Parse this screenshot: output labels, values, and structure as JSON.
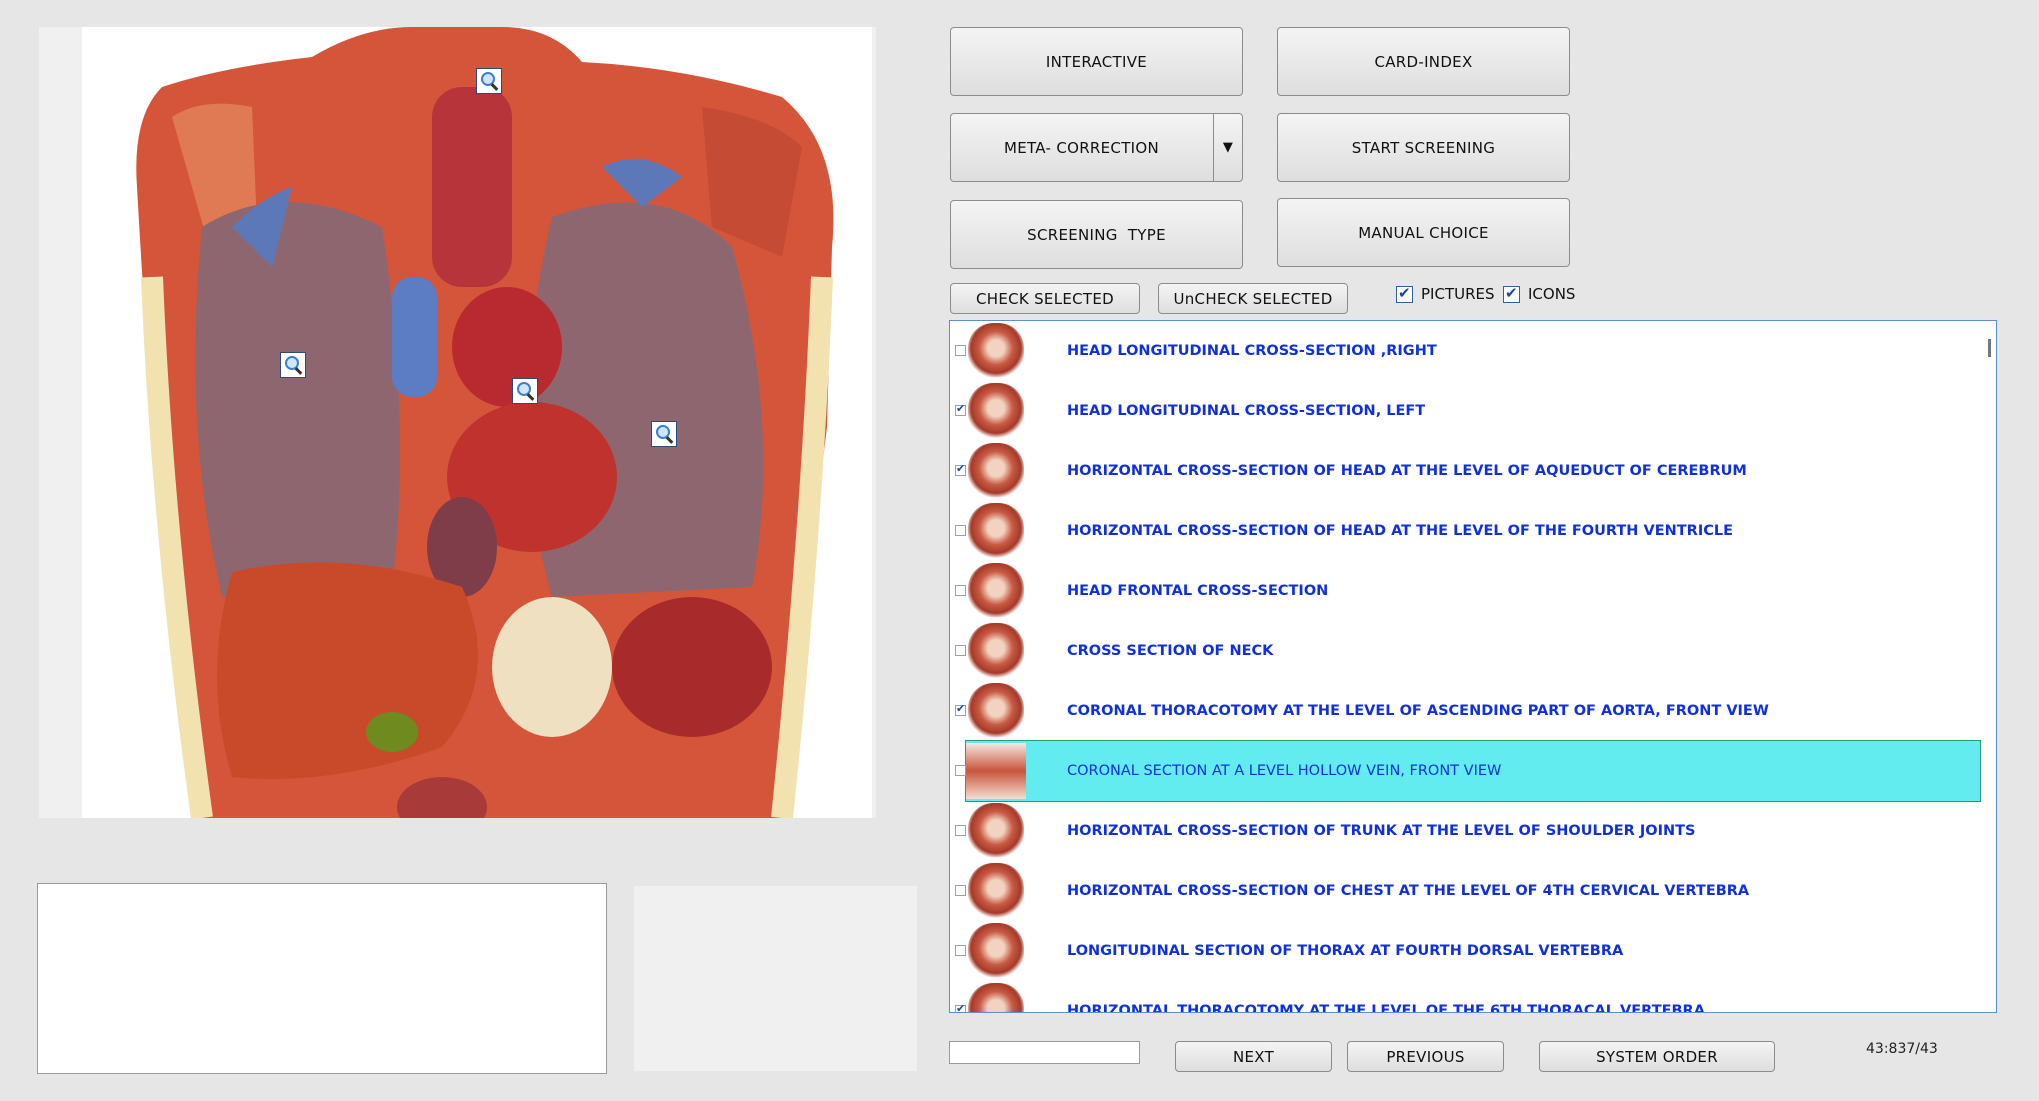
{
  "buttons": {
    "interactive": "INTERACTIVE",
    "card_index": "CARD-INDEX",
    "meta_correction": "META- CORRECTION",
    "meta_arrow": "▼",
    "start_screening": "START SCREENING",
    "screening_type": "SCREENING  TYPE",
    "manual_choice": "MANUAL CHOICE",
    "check_selected": "CHECK SELECTED",
    "uncheck_selected": "UnCHECK SELECTED",
    "next": "NEXT",
    "previous": "PREVIOUS",
    "system_order": "SYSTEM ORDER"
  },
  "options": {
    "pictures": {
      "label": "PICTURES",
      "checked": true
    },
    "icons": {
      "label": "ICONS",
      "checked": true
    }
  },
  "list": {
    "items": [
      {
        "label": "HEAD LONGITUDINAL CROSS-SECTION ,RIGHT",
        "checked": false,
        "selected": false
      },
      {
        "label": "HEAD LONGITUDINAL CROSS-SECTION, LEFT",
        "checked": true,
        "selected": false
      },
      {
        "label": "HORIZONTAL CROSS-SECTION OF HEAD AT THE LEVEL OF AQUEDUCT OF CEREBRUM",
        "checked": true,
        "selected": false
      },
      {
        "label": "HORIZONTAL CROSS-SECTION OF HEAD AT THE LEVEL OF THE FOURTH VENTRICLE",
        "checked": false,
        "selected": false
      },
      {
        "label": "HEAD FRONTAL CROSS-SECTION",
        "checked": false,
        "selected": false
      },
      {
        "label": "CROSS SECTION OF NECK",
        "checked": false,
        "selected": false
      },
      {
        "label": "CORONAL THORACOTOMY AT THE LEVEL OF ASCENDING PART OF AORTA, FRONT VIEW",
        "checked": true,
        "selected": false
      },
      {
        "label": "CORONAL SECTION AT A LEVEL HOLLOW VEIN, FRONT VIEW",
        "checked": false,
        "selected": true
      },
      {
        "label": "HORIZONTAL CROSS-SECTION OF TRUNK AT THE LEVEL OF SHOULDER JOINTS",
        "checked": false,
        "selected": false
      },
      {
        "label": "HORIZONTAL CROSS-SECTION OF CHEST AT THE LEVEL OF 4TH CERVICAL VERTEBRA",
        "checked": false,
        "selected": false
      },
      {
        "label": "LONGITUDINAL SECTION OF THORAX AT FOURTH DORSAL VERTEBRA",
        "checked": false,
        "selected": false
      },
      {
        "label": "HORIZONTAL THORACOTOMY AT THE LEVEL OF THE 6TH THORACAL VERTEBRA",
        "checked": true,
        "selected": false
      }
    ]
  },
  "status": {
    "counter": "43:837/43"
  },
  "colors": {
    "selected_row": "#63ecf0",
    "item_text": "#1030e0"
  }
}
